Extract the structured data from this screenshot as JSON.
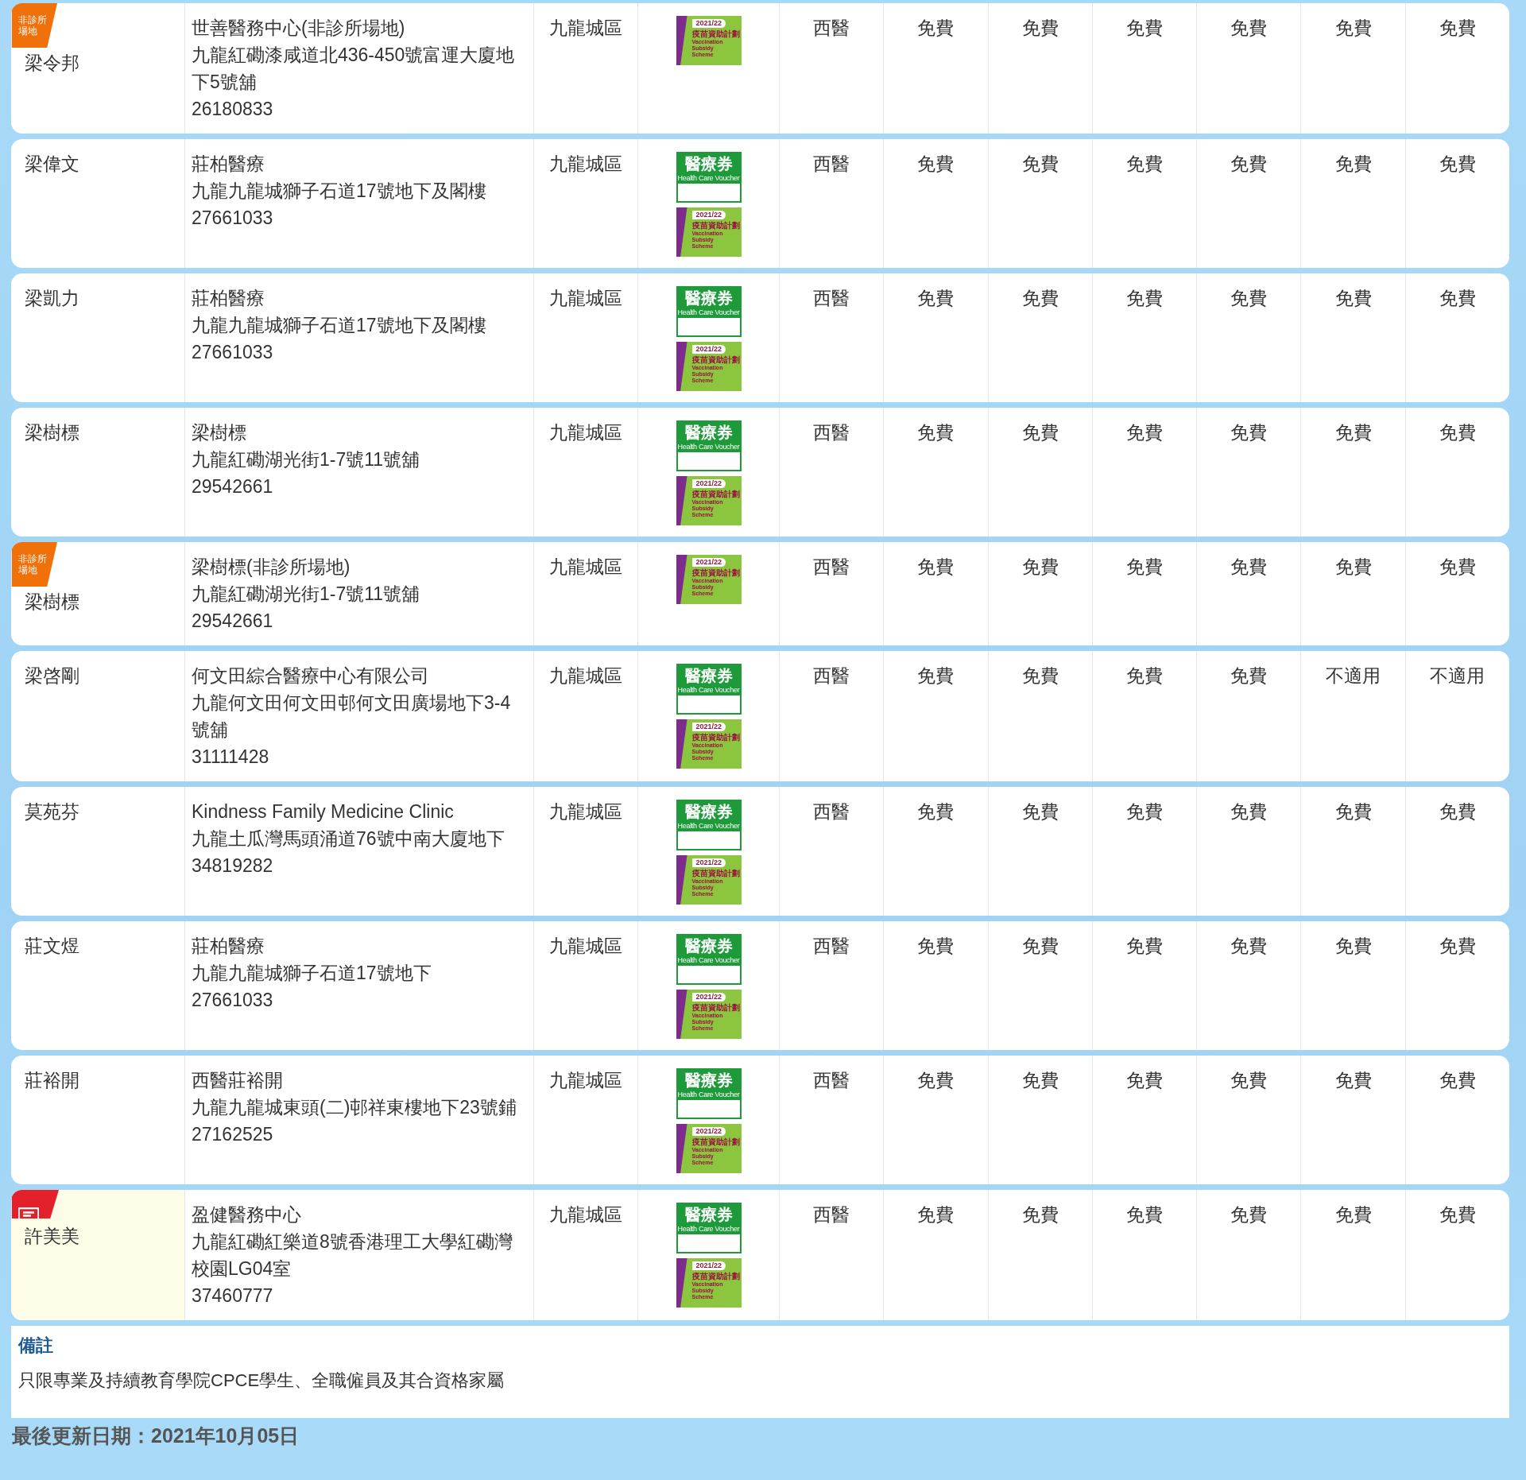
{
  "rows": [
    {
      "doctor": "梁令邦",
      "badge": {
        "kind": "offsite",
        "text": "非診所場地"
      },
      "highlighted": false,
      "clinic": "世善醫務中心(非診所場地)",
      "address": "九龍紅磡漆咸道北436-450號富運大廈地下5號舖",
      "phone": "26180833",
      "district": "九龍城區",
      "schemes": [
        {
          "kind": "vaccination",
          "year": "2021/22",
          "title": "疫苗資助計劃",
          "subtitle": "Vaccination Subsidy Scheme"
        }
      ],
      "service": "西醫",
      "fees": [
        "免費",
        "免費",
        "免費",
        "免費",
        "免費",
        "免費"
      ]
    },
    {
      "doctor": "梁偉文",
      "highlighted": false,
      "clinic": "莊柏醫療",
      "address": "九龍九龍城獅子石道17號地下及閣樓",
      "phone": "27661033",
      "district": "九龍城區",
      "schemes": [
        {
          "kind": "voucher",
          "title": "醫療券",
          "subtitle": "Health Care Voucher"
        },
        {
          "kind": "vaccination",
          "year": "2021/22",
          "title": "疫苗資助計劃",
          "subtitle": "Vaccination Subsidy Scheme"
        }
      ],
      "service": "西醫",
      "fees": [
        "免費",
        "免費",
        "免費",
        "免費",
        "免費",
        "免費"
      ]
    },
    {
      "doctor": "梁凱力",
      "highlighted": false,
      "clinic": "莊柏醫療",
      "address": "九龍九龍城獅子石道17號地下及閣樓",
      "phone": "27661033",
      "district": "九龍城區",
      "schemes": [
        {
          "kind": "voucher",
          "title": "醫療券",
          "subtitle": "Health Care Voucher"
        },
        {
          "kind": "vaccination",
          "year": "2021/22",
          "title": "疫苗資助計劃",
          "subtitle": "Vaccination Subsidy Scheme"
        }
      ],
      "service": "西醫",
      "fees": [
        "免費",
        "免費",
        "免費",
        "免費",
        "免費",
        "免費"
      ]
    },
    {
      "doctor": "梁樹標",
      "highlighted": false,
      "clinic": "梁樹標",
      "address": "九龍紅磡湖光街1-7號11號舖",
      "phone": "29542661",
      "district": "九龍城區",
      "schemes": [
        {
          "kind": "voucher",
          "title": "醫療券",
          "subtitle": "Health Care Voucher"
        },
        {
          "kind": "vaccination",
          "year": "2021/22",
          "title": "疫苗資助計劃",
          "subtitle": "Vaccination Subsidy Scheme"
        }
      ],
      "service": "西醫",
      "fees": [
        "免費",
        "免費",
        "免費",
        "免費",
        "免費",
        "免費"
      ]
    },
    {
      "doctor": "梁樹標",
      "badge": {
        "kind": "offsite",
        "text": "非診所場地"
      },
      "highlighted": false,
      "clinic": "梁樹標(非診所場地)",
      "address": "九龍紅磡湖光街1-7號11號舖",
      "phone": "29542661",
      "district": "九龍城區",
      "schemes": [
        {
          "kind": "vaccination",
          "year": "2021/22",
          "title": "疫苗資助計劃",
          "subtitle": "Vaccination Subsidy Scheme"
        }
      ],
      "service": "西醫",
      "fees": [
        "免費",
        "免費",
        "免費",
        "免費",
        "免費",
        "免費"
      ]
    },
    {
      "doctor": "梁啓剛",
      "highlighted": false,
      "clinic": "何文田綜合醫療中心有限公司",
      "address": "九龍何文田何文田邨何文田廣場地下3-4號舖",
      "phone": "31111428",
      "district": "九龍城區",
      "schemes": [
        {
          "kind": "voucher",
          "title": "醫療券",
          "subtitle": "Health Care Voucher"
        },
        {
          "kind": "vaccination",
          "year": "2021/22",
          "title": "疫苗資助計劃",
          "subtitle": "Vaccination Subsidy Scheme"
        }
      ],
      "service": "西醫",
      "fees": [
        "免費",
        "免費",
        "免費",
        "免費",
        "不適用",
        "不適用"
      ]
    },
    {
      "doctor": "莫苑芬",
      "highlighted": false,
      "clinic": "Kindness Family Medicine Clinic",
      "address": "九龍土瓜灣馬頭涌道76號中南大廈地下",
      "phone": "34819282",
      "district": "九龍城區",
      "schemes": [
        {
          "kind": "voucher",
          "title": "醫療券",
          "subtitle": "Health Care Voucher"
        },
        {
          "kind": "vaccination",
          "year": "2021/22",
          "title": "疫苗資助計劃",
          "subtitle": "Vaccination Subsidy Scheme"
        }
      ],
      "service": "西醫",
      "fees": [
        "免費",
        "免費",
        "免費",
        "免費",
        "免費",
        "免費"
      ]
    },
    {
      "doctor": "莊文煜",
      "highlighted": false,
      "clinic": "莊柏醫療",
      "address": "九龍九龍城獅子石道17號地下",
      "phone": "27661033",
      "district": "九龍城區",
      "schemes": [
        {
          "kind": "voucher",
          "title": "醫療券",
          "subtitle": "Health Care Voucher"
        },
        {
          "kind": "vaccination",
          "year": "2021/22",
          "title": "疫苗資助計劃",
          "subtitle": "Vaccination Subsidy Scheme"
        }
      ],
      "service": "西醫",
      "fees": [
        "免費",
        "免費",
        "免費",
        "免費",
        "免費",
        "免費"
      ]
    },
    {
      "doctor": "莊裕開",
      "highlighted": false,
      "clinic": "西醫莊裕開",
      "address": "九龍九龍城東頭(二)邨祥東樓地下23號鋪",
      "phone": "27162525",
      "district": "九龍城區",
      "schemes": [
        {
          "kind": "voucher",
          "title": "醫療券",
          "subtitle": "Health Care Voucher"
        },
        {
          "kind": "vaccination",
          "year": "2021/22",
          "title": "疫苗資助計劃",
          "subtitle": "Vaccination Subsidy Scheme"
        }
      ],
      "service": "西醫",
      "fees": [
        "免費",
        "免費",
        "免費",
        "免費",
        "免費",
        "免費"
      ]
    },
    {
      "doctor": "許美美",
      "badge": {
        "kind": "message"
      },
      "highlighted": true,
      "clinic": "盈健醫務中心",
      "address": "九龍紅磡紅樂道8號香港理工大學紅磡灣校園LG04室",
      "phone": "37460777",
      "district": "九龍城區",
      "schemes": [
        {
          "kind": "voucher",
          "title": "醫療券",
          "subtitle": "Health Care Voucher"
        },
        {
          "kind": "vaccination",
          "year": "2021/22",
          "title": "疫苗資助計劃",
          "subtitle": "Vaccination Subsidy Scheme"
        }
      ],
      "service": "西醫",
      "fees": [
        "免費",
        "免費",
        "免費",
        "免費",
        "免費",
        "免費"
      ]
    }
  ],
  "notes": {
    "title": "備註",
    "text": "只限專業及持續教育學院CPCE學生、全職僱員及其合資格家屬"
  },
  "last_updated": "最後更新日期：2021年10月05日"
}
